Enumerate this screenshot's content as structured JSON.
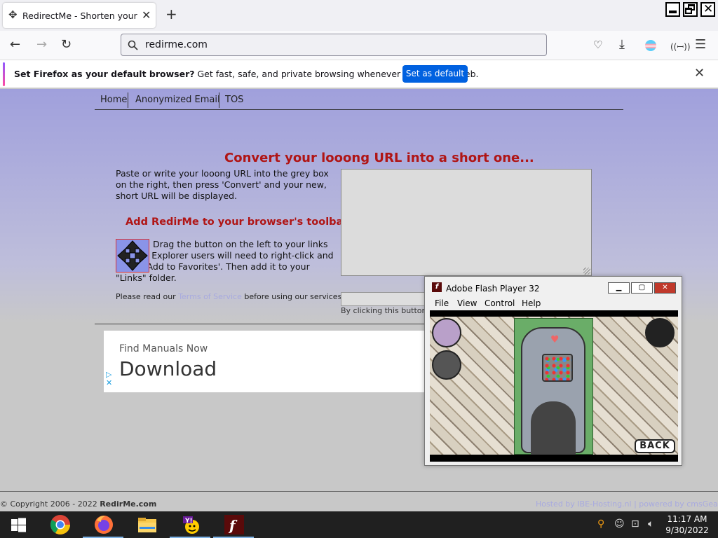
{
  "browser": {
    "tab_title": "RedirectMe - Shorten your URL",
    "url": "redirme.com",
    "notification": {
      "bold": "Set Firefox as your default browser?",
      "text": " Get fast, safe, and private browsing whenever you use the web.",
      "button": "Set as default"
    }
  },
  "site_nav": [
    "Home",
    "Anonymized Email",
    "TOS"
  ],
  "main": {
    "heading": "Convert your looong URL into a short one...",
    "instructions": "Paste or write your looong URL into the grey box on the right, then press 'Convert' and your new, short URL will be displayed.",
    "toolbar_heading": "Add RedirMe to your browser's toolbar",
    "drag_text": "Drag the button on the left to your links toolbar. Explorer users will need to right-click and select 'Add to Favorites'. Then add it to your \"Links\" folder.",
    "terms_before": "Please read our ",
    "terms_link": "Terms of Service",
    "terms_after": " before using our services.",
    "click_note": "By clicking this button y"
  },
  "ad": {
    "small": "Find Manuals Now",
    "big": "Download"
  },
  "footer": {
    "copyright": "© Copyright 2006 - 2022 ",
    "site": "RedirMe.com",
    "hosted": "Hosted by IBE-Hosting.nl | powered by cmsGear"
  },
  "flash": {
    "title": "Adobe Flash Player 32",
    "menu": [
      "File",
      "View",
      "Control",
      "Help"
    ],
    "back_label": "BACK"
  },
  "taskbar": {
    "time": "11:17 AM",
    "date": "9/30/2022"
  },
  "colors": {
    "heading_red": "#b01515",
    "firefox_blue": "#0061e0",
    "page_purple": "#a0a0dc"
  }
}
